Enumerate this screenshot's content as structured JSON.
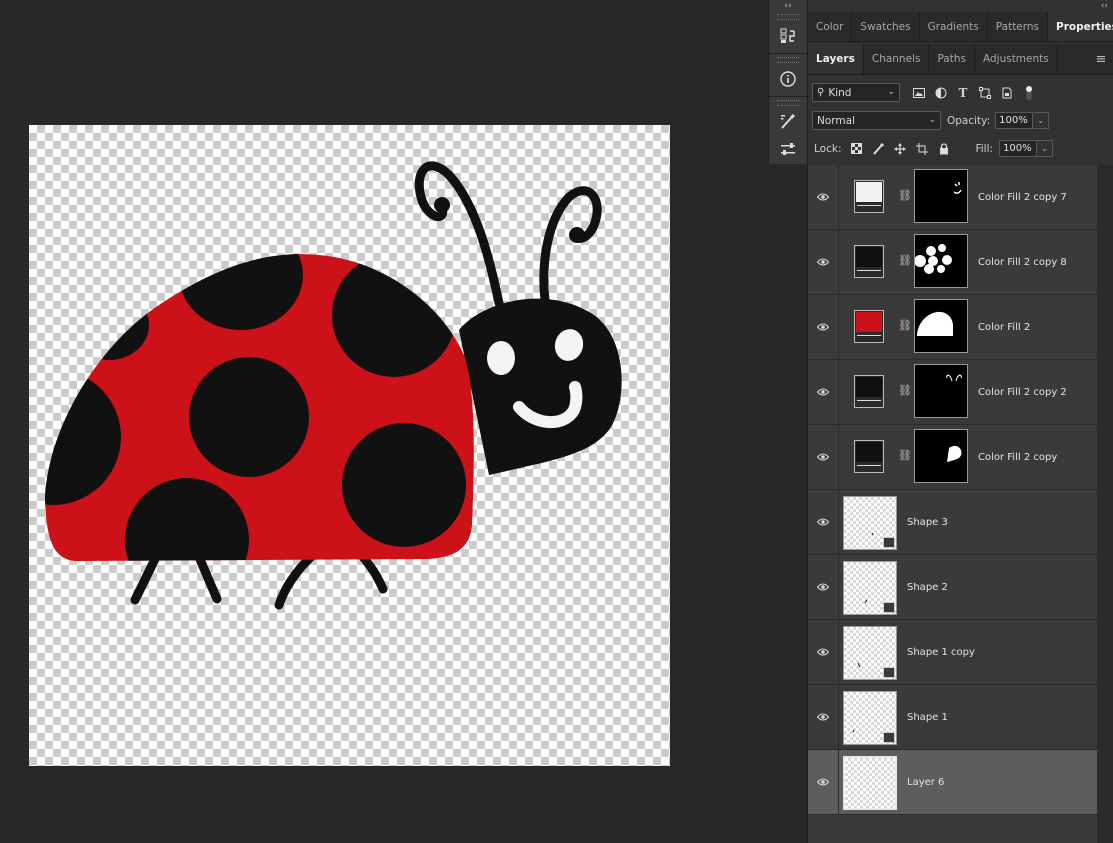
{
  "canvas": {
    "colors": {
      "red": "#cc1119",
      "black": "#111111",
      "white": "#f4f4f4"
    }
  },
  "toolstrip": {
    "collapse": "‹‹",
    "tools": [
      {
        "name": "history-icon",
        "glyph": "⎌"
      },
      {
        "name": "info-icon",
        "glyph": "ⓘ"
      },
      {
        "name": "brush-settings-icon",
        "glyph": "🖌"
      },
      {
        "name": "adjust-sliders-icon",
        "glyph": "⚌"
      }
    ]
  },
  "panel_top": {
    "collapse": "‹‹",
    "tabs": [
      "Color",
      "Swatches",
      "Gradients",
      "Patterns",
      "Properties"
    ],
    "active": "Properties"
  },
  "layers_panel": {
    "tabs": [
      "Layers",
      "Channels",
      "Paths",
      "Adjustments"
    ],
    "active": "Layers",
    "filter": {
      "value": "Kind",
      "search_glyph": "🔍"
    },
    "blend_mode": "Normal",
    "opacity_label": "Opacity:",
    "opacity_value": "100%",
    "lock_label": "Lock:",
    "fill_label": "Fill:",
    "fill_value": "100%",
    "layers": [
      {
        "name": "Color Fill 2 copy 7",
        "type": "fill",
        "swatch": "#f2f2f2"
      },
      {
        "name": "Color Fill 2 copy 8",
        "type": "fill",
        "swatch": "#111111"
      },
      {
        "name": "Color Fill 2",
        "type": "fill",
        "swatch": "#cc1119"
      },
      {
        "name": "Color Fill 2 copy 2",
        "type": "fill",
        "swatch": "#111111"
      },
      {
        "name": "Color Fill 2 copy",
        "type": "fill",
        "swatch": "#111111"
      },
      {
        "name": "Shape 3",
        "type": "shape"
      },
      {
        "name": "Shape 2",
        "type": "shape"
      },
      {
        "name": "Shape 1 copy",
        "type": "shape"
      },
      {
        "name": "Shape 1",
        "type": "shape"
      },
      {
        "name": "Layer 6",
        "type": "pixel",
        "selected": true
      }
    ]
  }
}
